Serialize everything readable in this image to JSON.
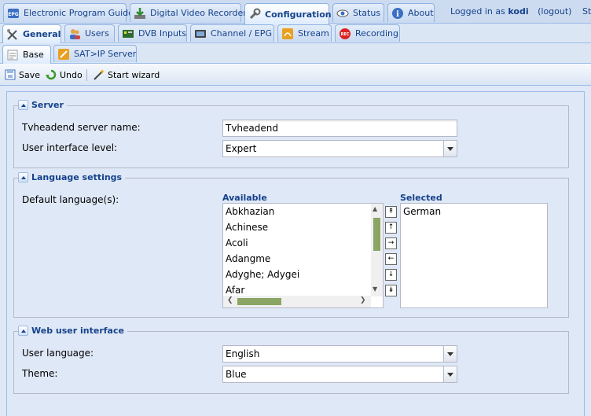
{
  "top_tabs": [
    {
      "label": "Electronic Program Guide",
      "icon": "epg-icon"
    },
    {
      "label": "Digital Video Recorder",
      "icon": "download-icon"
    },
    {
      "label": "Configuration",
      "icon": "wrench-icon",
      "active": true
    },
    {
      "label": "Status",
      "icon": "eye-icon"
    },
    {
      "label": "About",
      "icon": "info-icon"
    }
  ],
  "login": {
    "prefix": "Logged in as",
    "user": "kodi",
    "logout": "(logout)",
    "extra": "Stor"
  },
  "config_tabs": [
    {
      "label": "General",
      "icon": "tools-icon",
      "active": true
    },
    {
      "label": "Users",
      "icon": "users-icon"
    },
    {
      "label": "DVB Inputs",
      "icon": "card-icon"
    },
    {
      "label": "Channel / EPG",
      "icon": "tv-icon"
    },
    {
      "label": "Stream",
      "icon": "stream-icon"
    },
    {
      "label": "Recording",
      "icon": "rec-icon"
    }
  ],
  "general_tabs": [
    {
      "label": "Base",
      "icon": "base-icon",
      "active": true
    },
    {
      "label": "SAT>IP Server",
      "icon": "satip-icon"
    }
  ],
  "toolbar": {
    "save": "Save",
    "undo": "Undo",
    "wizard": "Start wizard"
  },
  "server": {
    "legend": "Server",
    "name_label": "Tvheadend server name:",
    "name_value": "Tvheadend",
    "uilevel_label": "User interface level:",
    "uilevel_value": "Expert"
  },
  "language": {
    "legend": "Language settings",
    "default_label": "Default language(s):",
    "available_header": "Available",
    "selected_header": "Selected",
    "available": [
      "Abkhazian",
      "Achinese",
      "Acoli",
      "Adangme",
      "Adyghe; Adygei",
      "Afar"
    ],
    "selected": [
      "German"
    ]
  },
  "webui": {
    "legend": "Web user interface",
    "language_label": "User language:",
    "language_value": "English",
    "theme_label": "Theme:",
    "theme_value": "Blue"
  }
}
